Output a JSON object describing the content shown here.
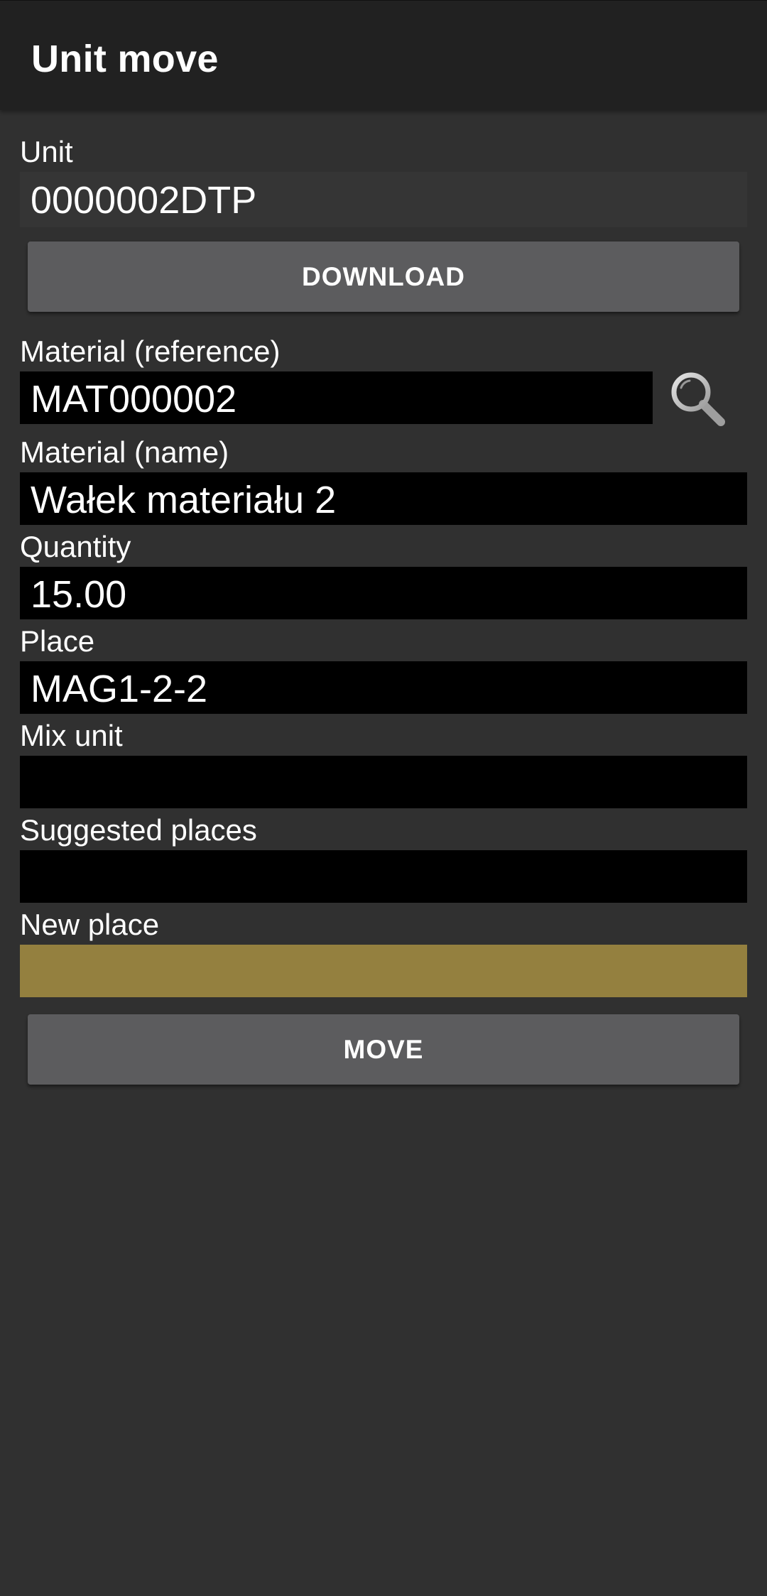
{
  "toolbar": {
    "title": "Unit move"
  },
  "unit": {
    "label": "Unit",
    "value": "0000002DTP"
  },
  "download_button": {
    "label": "DOWNLOAD"
  },
  "material_reference": {
    "label": "Material (reference)",
    "value": "MAT000002",
    "search_icon": "search-icon"
  },
  "material_name": {
    "label": "Material (name)",
    "value": "Wałek materiału 2"
  },
  "quantity": {
    "label": "Quantity",
    "value": "15.00"
  },
  "place": {
    "label": "Place",
    "value": "MAG1-2-2"
  },
  "mix_unit": {
    "label": "Mix unit",
    "value": ""
  },
  "suggested_places": {
    "label": "Suggested places",
    "value": ""
  },
  "new_place": {
    "label": "New place",
    "value": "",
    "color": "#94803f"
  },
  "move_button": {
    "label": "MOVE"
  },
  "colors": {
    "background": "#303030",
    "toolbar": "#212121",
    "field": "#000000",
    "button": "#5c5c5e"
  }
}
